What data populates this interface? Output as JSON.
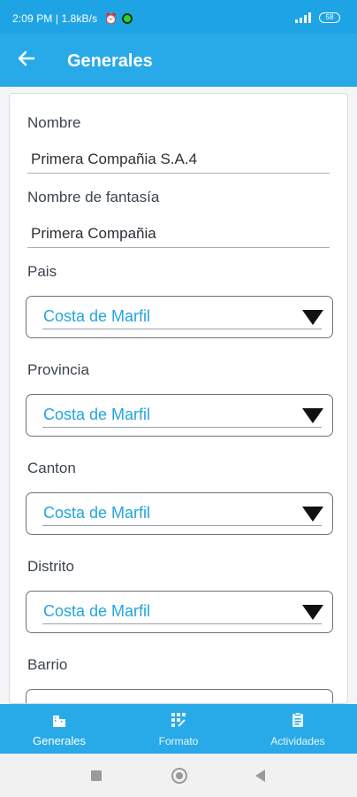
{
  "status_bar": {
    "time_speed": "2:09 PM | 1.8kB/s",
    "alarm_icon": "alarm-clock-icon",
    "app_icon": "green-circle-icon",
    "battery": "58"
  },
  "app_bar": {
    "title": "Generales",
    "back_icon": "arrow-left-icon"
  },
  "form": {
    "fields": [
      {
        "label": "Nombre",
        "value": "Primera Compañia S.A.4"
      },
      {
        "label": "Nombre de fantasía",
        "value": "Primera Compañia"
      }
    ],
    "selects": [
      {
        "label": "Pais",
        "value": "Costa de Marfil"
      },
      {
        "label": "Provincia",
        "value": "Costa de Marfil"
      },
      {
        "label": "Canton",
        "value": "Costa de Marfil"
      },
      {
        "label": "Distrito",
        "value": "Costa de Marfil"
      },
      {
        "label": "Barrio",
        "value": ""
      }
    ]
  },
  "bottom_nav": {
    "items": [
      {
        "label": "Generales",
        "icon": "buildings-icon"
      },
      {
        "label": "Formato",
        "icon": "format-grid-icon"
      },
      {
        "label": "Actividades",
        "icon": "clipboard-icon"
      }
    ]
  },
  "colors": {
    "status_bar": "#1ea4e4",
    "app_bar": "#29aae8",
    "select_value": "#22a5de"
  }
}
